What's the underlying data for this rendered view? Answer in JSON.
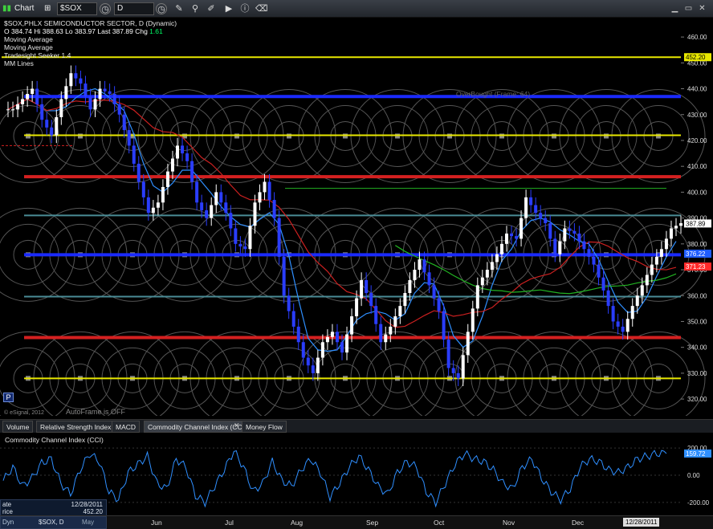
{
  "toolbar": {
    "chart_label": "Chart",
    "symbol": "$SOX",
    "interval": "D"
  },
  "legend": {
    "title": "$SOX,PHLX SEMICONDUCTOR SECTOR, D (Dynamic)",
    "open_label": "O",
    "open": "384.74",
    "high_label": "Hi",
    "high": "388.63",
    "low_label": "Lo",
    "low": "383.97",
    "last_label": "Last",
    "last": "387.89",
    "chg_label": "Chg",
    "chg": "1.61",
    "studies": [
      "Moving Average",
      "Moving Average",
      "Tradesight Seeker 1.4",
      "MM Lines"
    ]
  },
  "annotations": {
    "overbought": "OverBought (Frame: 64)",
    "autoframe": "AutoFrame is OFF",
    "copyright": "© eSignal, 2012",
    "p_button": "P"
  },
  "price_axis": {
    "ticks": [
      "460.00",
      "450.00",
      "440.00",
      "430.00",
      "420.00",
      "410.00",
      "400.00",
      "390.00",
      "380.00",
      "370.00",
      "360.00",
      "350.00",
      "340.00",
      "330.00",
      "320.00"
    ],
    "tags": [
      {
        "value": "452.20",
        "color": "#e8e800",
        "text_color": "#000"
      },
      {
        "value": "387.89",
        "color": "#ffffff",
        "text_color": "#000"
      },
      {
        "value": "376.22",
        "color": "#1f5cff",
        "text_color": "#fff"
      },
      {
        "value": "371.23",
        "color": "#ff2a2a",
        "text_color": "#fff"
      }
    ]
  },
  "tabs": [
    "Volume",
    "Relative Strength Index",
    "MACD",
    "Commodity Channel Index (CCI)",
    "Money Flow"
  ],
  "cci": {
    "title": "Commodity Channel Index (CCI)",
    "ticks": [
      "200.00",
      "0.00",
      "-200.00"
    ],
    "tag": "159.72"
  },
  "info": {
    "date_label": "ate",
    "date": "12/28/2011",
    "price_label": "rice",
    "price": "452.20",
    "footer_left": "Dyn",
    "footer_symbol": "$SOX, D",
    "footer_month": "May"
  },
  "xaxis": {
    "months": [
      "Jun",
      "Jul",
      "Aug",
      "Sep",
      "Oct",
      "Nov",
      "Dec"
    ],
    "current": "12/28/2011"
  },
  "colors": {
    "yellow": "#e8e800",
    "red": "#d42020",
    "blue": "#1a2aff",
    "teal": "#4a8c96",
    "up": "#ffffff",
    "down": "#2a3dff",
    "ma_fast": "#2f8fff",
    "ma_slow": "#cc2020",
    "ma_green": "#22b322"
  },
  "chart_data": {
    "type": "candlestick",
    "y_range": [
      316,
      465
    ],
    "price_levels": [
      {
        "value": 452.2,
        "color": "yellow"
      },
      {
        "value": 437,
        "color": "blue"
      },
      {
        "value": 422,
        "color": "yellow"
      },
      {
        "value": 406,
        "color": "red"
      },
      {
        "value": 391,
        "color": "teal"
      },
      {
        "value": 375.8,
        "color": "blue"
      },
      {
        "value": 359.6,
        "color": "teal"
      },
      {
        "value": 343.8,
        "color": "red"
      },
      {
        "value": 328,
        "color": "yellow"
      }
    ],
    "close_path": [
      432,
      436,
      440,
      428,
      422,
      436,
      446,
      442,
      432,
      440,
      438,
      430,
      418,
      404,
      392,
      396,
      408,
      418,
      412,
      396,
      390,
      400,
      392,
      380,
      378,
      396,
      404,
      390,
      360,
      348,
      336,
      330,
      342,
      346,
      338,
      352,
      366,
      356,
      342,
      348,
      356,
      366,
      374,
      364,
      354,
      332,
      328,
      346,
      364,
      370,
      376,
      384,
      382,
      398,
      392,
      388,
      376,
      386,
      384,
      378,
      372,
      362,
      350,
      346,
      356,
      364,
      372,
      378,
      386,
      388
    ],
    "cci_path": [
      -40,
      60,
      -80,
      -20,
      90,
      120,
      -60,
      -140,
      40,
      160,
      100,
      -120,
      -180,
      20,
      80,
      140,
      -60,
      -100,
      120,
      60,
      -150,
      -200,
      -80,
      40,
      180,
      60,
      -120,
      -60,
      100,
      -40,
      -80,
      40,
      120,
      20,
      -160,
      -60,
      60,
      140,
      40,
      -80,
      -140,
      20,
      100,
      60,
      -120,
      -200,
      -60,
      80,
      160,
      120,
      100,
      40,
      -60,
      -100,
      60,
      120,
      -20,
      -120,
      -180,
      -100,
      60,
      120,
      100,
      40,
      20,
      60,
      120,
      140,
      160,
      159.72
    ]
  }
}
